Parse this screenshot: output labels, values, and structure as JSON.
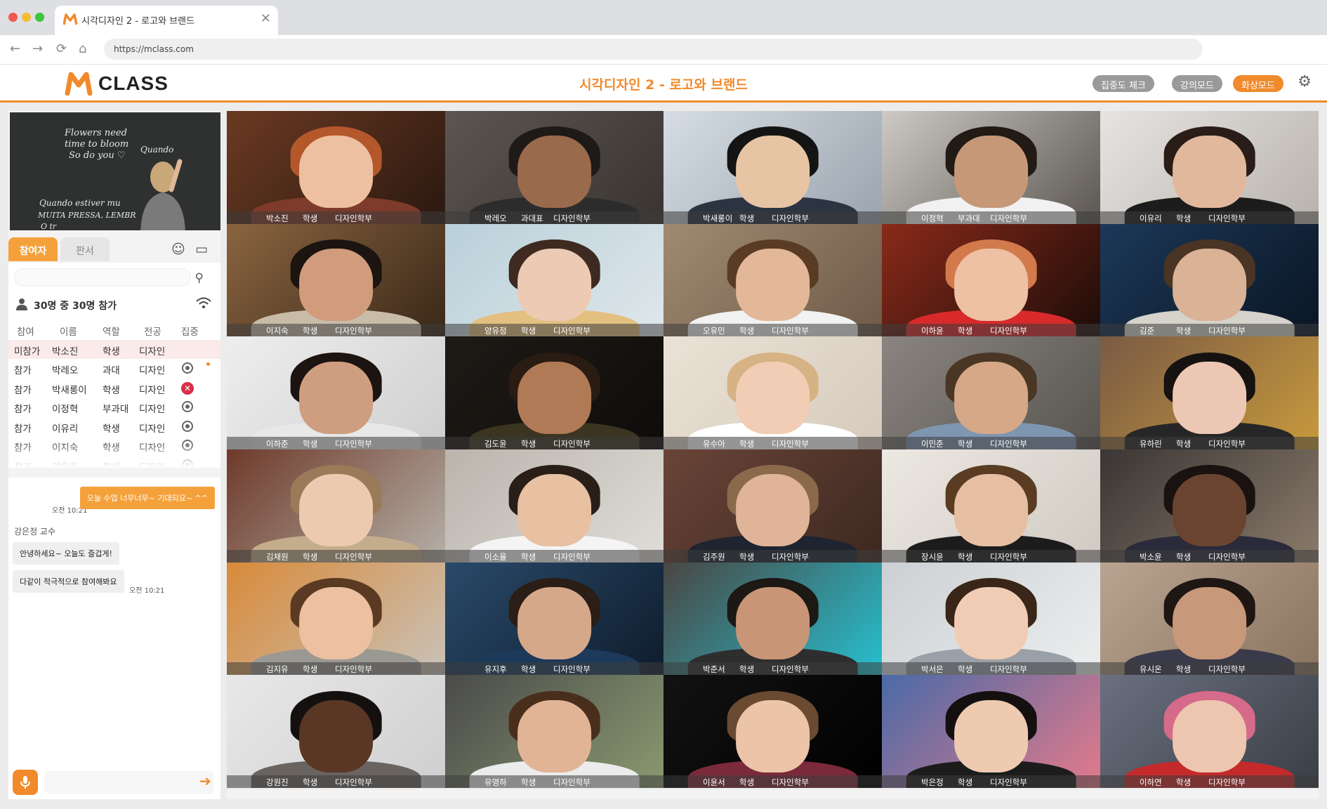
{
  "browser": {
    "tab_title": "시각디자인 2 - 로고와 브랜드",
    "tab_close": "✕",
    "url": "https://mclass.com"
  },
  "header": {
    "brand": "CLASS",
    "course_title": "시각디자인 2 - 로고와 브랜드",
    "buttons": [
      {
        "label": "집중도 체크",
        "color": "#9a9a9a"
      },
      {
        "label": "강의모드",
        "color": "#9a9a9a"
      },
      {
        "label": "화상모드",
        "color": "#f08a2b"
      }
    ],
    "accent": "#f08a2b"
  },
  "blackboard": {
    "lines": [
      "Flowers need",
      "time to bloom",
      "So do you ♡",
      "Quando ",
      "Quando estiver mu",
      "MUITA PRESSA, LEMBR",
      "O tr"
    ]
  },
  "sidebar": {
    "tabs": [
      {
        "label": "참여자"
      },
      {
        "label": "판서"
      }
    ],
    "search": {
      "placeholder": ""
    },
    "count": "30명 중 30명 참가",
    "columns": [
      "참여",
      "이름",
      "역할",
      "전공",
      "집중"
    ],
    "rows": [
      {
        "status": "미참가",
        "name": "박소진",
        "role": "학생",
        "major": "디자인",
        "focus": "none"
      },
      {
        "status": "참가",
        "name": "박레오",
        "role": "과대",
        "major": "디자인",
        "focus": "ok",
        "dot": true
      },
      {
        "status": "참가",
        "name": "박새롱이",
        "role": "학생",
        "major": "디자인",
        "focus": "bad"
      },
      {
        "status": "참가",
        "name": "이정혁",
        "role": "부과대",
        "major": "디자인",
        "focus": "ok"
      },
      {
        "status": "참가",
        "name": "이유리",
        "role": "학생",
        "major": "디자인",
        "focus": "ok"
      },
      {
        "status": "참가",
        "name": "이지숙",
        "role": "학생",
        "major": "디자인",
        "focus": "ok"
      },
      {
        "status": "참가",
        "name": "양유정",
        "role": "학생",
        "major": "디자인",
        "focus": "ok"
      }
    ]
  },
  "chat": {
    "my_message": "오늘 수업 너무너무~ 기대되요~ ^^",
    "my_time": "오전 10:21",
    "sender": "강은정 교수",
    "messages": [
      {
        "text": "안녕하세요~ 오늘도 즐겁게!"
      },
      {
        "text": "다같이 적극적으로 참여해봐요",
        "time": "오전 10:21"
      }
    ],
    "input_placeholder": ""
  },
  "tiles": [
    {
      "name": "박소진",
      "role": "학생",
      "dept": "디자인학부",
      "bg": "#6b3a22",
      "bg2": "#2a1810",
      "skin": "#eec0a2",
      "hair": "#b4582c",
      "shirt": "#7e3a2a"
    },
    {
      "name": "박레오",
      "role": "과대표",
      "dept": "디자인학부",
      "bg": "#5c5652",
      "bg2": "#3a3430",
      "skin": "#9a6a4c",
      "hair": "#1e1a18",
      "shirt": "#2c2c2c"
    },
    {
      "name": "박새롱이",
      "role": "학생",
      "dept": "디자인학부",
      "bg": "#d6dde4",
      "bg2": "#9aa4ae",
      "skin": "#e7c4a4",
      "hair": "#141414",
      "shirt": "#2c3442"
    },
    {
      "name": "이정혁",
      "role": "부과대",
      "dept": "디자인학부",
      "bg": "#cdcac4",
      "bg2": "#5a5550",
      "skin": "#c79878",
      "hair": "#221a14",
      "shirt": "#f1f1f1"
    },
    {
      "name": "이유리",
      "role": "학생",
      "dept": "디자인학부",
      "bg": "#e6e4e2",
      "bg2": "#b8b2ac",
      "skin": "#e2b89c",
      "hair": "#2a1d18",
      "shirt": "#1c1c1c"
    },
    {
      "name": "이지숙",
      "role": "학생",
      "dept": "디자인학부",
      "bg": "#8a6440",
      "bg2": "#3a2818",
      "skin": "#d09c7c",
      "hair": "#1c1410",
      "shirt": "#c8bca8"
    },
    {
      "name": "양유정",
      "role": "학생",
      "dept": "디자인학부",
      "bg": "#b9d0da",
      "bg2": "#dfe7ea",
      "skin": "#eccab4",
      "hair": "#3e2a20",
      "shirt": "#e4c080"
    },
    {
      "name": "오유민",
      "role": "학생",
      "dept": "디자인학부",
      "bg": "#a08a72",
      "bg2": "#6e5a48",
      "skin": "#e2b898",
      "hair": "#5a3c24",
      "shirt": "#f2f2f2"
    },
    {
      "name": "이하윤",
      "role": "학생",
      "dept": "디자인학부",
      "bg": "#8a2a1a",
      "bg2": "#1c0c08",
      "skin": "#eec0a4",
      "hair": "#d27a4c",
      "shirt": "#d82a2a"
    },
    {
      "name": "김준",
      "role": "학생",
      "dept": "디자인학부",
      "bg": "#1c3858",
      "bg2": "#0a1624",
      "skin": "#dab296",
      "hair": "#4a3424",
      "shirt": "#d6d2cc"
    },
    {
      "name": "이하준",
      "role": "학생",
      "dept": "디자인학부",
      "bg": "#eeeeee",
      "bg2": "#cfcfcf",
      "skin": "#cf9e80",
      "hair": "#1c1410",
      "shirt": "#e8e8e8"
    },
    {
      "name": "김도윤",
      "role": "학생",
      "dept": "디자인학부",
      "bg": "#1e1a16",
      "bg2": "#0e0c0a",
      "skin": "#b07a56",
      "hair": "#2a1c12",
      "shirt": "#3a3420"
    },
    {
      "name": "유수아",
      "role": "학생",
      "dept": "디자인학부",
      "bg": "#eae2d6",
      "bg2": "#d6cabb",
      "skin": "#f0cdb4",
      "hair": "#d6b284",
      "shirt": "#ffffff"
    },
    {
      "name": "이민준",
      "role": "학생",
      "dept": "디자인학부",
      "bg": "#8a8580",
      "bg2": "#58544e",
      "skin": "#d6a888",
      "hair": "#4a3624",
      "shirt": "#7e96b0"
    },
    {
      "name": "유하린",
      "role": "학생",
      "dept": "디자인학부",
      "bg": "#7a5a44",
      "bg2": "#c89a3c",
      "skin": "#ecc8b4",
      "hair": "#161212",
      "shirt": "#262626"
    },
    {
      "name": "김채원",
      "role": "학생",
      "dept": "디자인학부",
      "bg": "#6e3a2a",
      "bg2": "#b6b0a8",
      "skin": "#eccab0",
      "hair": "#9a7a58",
      "shirt": "#c4ad8c"
    },
    {
      "name": "이소율",
      "role": "학생",
      "dept": "디자인학부",
      "bg": "#b9b4ac",
      "bg2": "#e0ddd8",
      "skin": "#e8c0a2",
      "hair": "#2a1e18",
      "shirt": "#f4f4f4"
    },
    {
      "name": "김주원",
      "role": "학생",
      "dept": "디자인학부",
      "bg": "#6a4438",
      "bg2": "#3c2820",
      "skin": "#e0b498",
      "hair": "#8a6a4a",
      "shirt": "#1e2430"
    },
    {
      "name": "장시윤",
      "role": "학생",
      "dept": "디자인학부",
      "bg": "#ece8e2",
      "bg2": "#d0cac2",
      "skin": "#e6bfa2",
      "hair": "#5a3c22",
      "shirt": "#1c1c1c"
    },
    {
      "name": "박소윤",
      "role": "학생",
      "dept": "디자인학부",
      "bg": "#3a3634",
      "bg2": "#8a7a6a",
      "skin": "#6a4430",
      "hair": "#1a1210",
      "shirt": "#2a2a3a"
    },
    {
      "name": "김지유",
      "role": "학생",
      "dept": "디자인학부",
      "bg": "#d88a3a",
      "bg2": "#c9c2b8",
      "skin": "#ecc0a0",
      "hair": "#5a3a22",
      "shirt": "#9a9892"
    },
    {
      "name": "유지후",
      "role": "학생",
      "dept": "디자인학부",
      "bg": "#2a4a6a",
      "bg2": "#0e1c2c",
      "skin": "#d6a88a",
      "hair": "#2a1e16",
      "shirt": "#1e3a5a"
    },
    {
      "name": "박준서",
      "role": "학생",
      "dept": "디자인학부",
      "bg": "#4a4642",
      "bg2": "#26c0d0",
      "skin": "#c89676",
      "hair": "#1c1814",
      "shirt": "#2e2e2e"
    },
    {
      "name": "박서은",
      "role": "학생",
      "dept": "디자인학부",
      "bg": "#ccd0d4",
      "bg2": "#eceeee",
      "skin": "#f0ccb4",
      "hair": "#3a2618",
      "shirt": "#9aa0a8"
    },
    {
      "name": "유시온",
      "role": "학생",
      "dept": "디자인학부",
      "bg": "#b8a490",
      "bg2": "#8a7460",
      "skin": "#c8987a",
      "hair": "#1e1612",
      "shirt": "#3a3a4a"
    },
    {
      "name": "강원진",
      "role": "학생",
      "dept": "디자인학부",
      "bg": "#e8e8e8",
      "bg2": "#cfcfcf",
      "skin": "#5a3624",
      "hair": "#141010",
      "shirt": "#6a6460"
    },
    {
      "name": "유영하",
      "role": "학생",
      "dept": "디자인학부",
      "bg": "#4a4a4a",
      "bg2": "#8a9a70",
      "skin": "#e2b496",
      "hair": "#4a2e1c",
      "shirt": "#ececec"
    },
    {
      "name": "이윤서",
      "role": "학생",
      "dept": "디자인학부",
      "bg": "#121212",
      "bg2": "#000000",
      "skin": "#ecc4a8",
      "hair": "#6a4a30",
      "shirt": "#7a2a3a"
    },
    {
      "name": "박은정",
      "role": "학생",
      "dept": "디자인학부",
      "bg": "#4a6aa8",
      "bg2": "#e47a8a",
      "skin": "#eecab0",
      "hair": "#141010",
      "shirt": "#1c1c1c"
    },
    {
      "name": "이하연",
      "role": "학생",
      "dept": "디자인학부",
      "bg": "#6a7080",
      "bg2": "#3a3e46",
      "skin": "#ecc6ae",
      "hair": "#d66a8a",
      "shirt": "#c42a2a"
    }
  ]
}
